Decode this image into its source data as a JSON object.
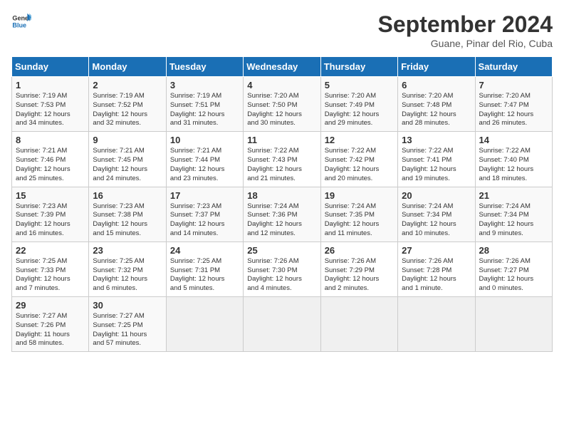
{
  "header": {
    "logo_line1": "General",
    "logo_line2": "Blue",
    "title": "September 2024",
    "subtitle": "Guane, Pinar del Rio, Cuba"
  },
  "days_of_week": [
    "Sunday",
    "Monday",
    "Tuesday",
    "Wednesday",
    "Thursday",
    "Friday",
    "Saturday"
  ],
  "weeks": [
    [
      {
        "num": "1",
        "info": "Sunrise: 7:19 AM\nSunset: 7:53 PM\nDaylight: 12 hours\nand 34 minutes."
      },
      {
        "num": "2",
        "info": "Sunrise: 7:19 AM\nSunset: 7:52 PM\nDaylight: 12 hours\nand 32 minutes."
      },
      {
        "num": "3",
        "info": "Sunrise: 7:19 AM\nSunset: 7:51 PM\nDaylight: 12 hours\nand 31 minutes."
      },
      {
        "num": "4",
        "info": "Sunrise: 7:20 AM\nSunset: 7:50 PM\nDaylight: 12 hours\nand 30 minutes."
      },
      {
        "num": "5",
        "info": "Sunrise: 7:20 AM\nSunset: 7:49 PM\nDaylight: 12 hours\nand 29 minutes."
      },
      {
        "num": "6",
        "info": "Sunrise: 7:20 AM\nSunset: 7:48 PM\nDaylight: 12 hours\nand 28 minutes."
      },
      {
        "num": "7",
        "info": "Sunrise: 7:20 AM\nSunset: 7:47 PM\nDaylight: 12 hours\nand 26 minutes."
      }
    ],
    [
      {
        "num": "8",
        "info": "Sunrise: 7:21 AM\nSunset: 7:46 PM\nDaylight: 12 hours\nand 25 minutes."
      },
      {
        "num": "9",
        "info": "Sunrise: 7:21 AM\nSunset: 7:45 PM\nDaylight: 12 hours\nand 24 minutes."
      },
      {
        "num": "10",
        "info": "Sunrise: 7:21 AM\nSunset: 7:44 PM\nDaylight: 12 hours\nand 23 minutes."
      },
      {
        "num": "11",
        "info": "Sunrise: 7:22 AM\nSunset: 7:43 PM\nDaylight: 12 hours\nand 21 minutes."
      },
      {
        "num": "12",
        "info": "Sunrise: 7:22 AM\nSunset: 7:42 PM\nDaylight: 12 hours\nand 20 minutes."
      },
      {
        "num": "13",
        "info": "Sunrise: 7:22 AM\nSunset: 7:41 PM\nDaylight: 12 hours\nand 19 minutes."
      },
      {
        "num": "14",
        "info": "Sunrise: 7:22 AM\nSunset: 7:40 PM\nDaylight: 12 hours\nand 18 minutes."
      }
    ],
    [
      {
        "num": "15",
        "info": "Sunrise: 7:23 AM\nSunset: 7:39 PM\nDaylight: 12 hours\nand 16 minutes."
      },
      {
        "num": "16",
        "info": "Sunrise: 7:23 AM\nSunset: 7:38 PM\nDaylight: 12 hours\nand 15 minutes."
      },
      {
        "num": "17",
        "info": "Sunrise: 7:23 AM\nSunset: 7:37 PM\nDaylight: 12 hours\nand 14 minutes."
      },
      {
        "num": "18",
        "info": "Sunrise: 7:24 AM\nSunset: 7:36 PM\nDaylight: 12 hours\nand 12 minutes."
      },
      {
        "num": "19",
        "info": "Sunrise: 7:24 AM\nSunset: 7:35 PM\nDaylight: 12 hours\nand 11 minutes."
      },
      {
        "num": "20",
        "info": "Sunrise: 7:24 AM\nSunset: 7:34 PM\nDaylight: 12 hours\nand 10 minutes."
      },
      {
        "num": "21",
        "info": "Sunrise: 7:24 AM\nSunset: 7:34 PM\nDaylight: 12 hours\nand 9 minutes."
      }
    ],
    [
      {
        "num": "22",
        "info": "Sunrise: 7:25 AM\nSunset: 7:33 PM\nDaylight: 12 hours\nand 7 minutes."
      },
      {
        "num": "23",
        "info": "Sunrise: 7:25 AM\nSunset: 7:32 PM\nDaylight: 12 hours\nand 6 minutes."
      },
      {
        "num": "24",
        "info": "Sunrise: 7:25 AM\nSunset: 7:31 PM\nDaylight: 12 hours\nand 5 minutes."
      },
      {
        "num": "25",
        "info": "Sunrise: 7:26 AM\nSunset: 7:30 PM\nDaylight: 12 hours\nand 4 minutes."
      },
      {
        "num": "26",
        "info": "Sunrise: 7:26 AM\nSunset: 7:29 PM\nDaylight: 12 hours\nand 2 minutes."
      },
      {
        "num": "27",
        "info": "Sunrise: 7:26 AM\nSunset: 7:28 PM\nDaylight: 12 hours\nand 1 minute."
      },
      {
        "num": "28",
        "info": "Sunrise: 7:26 AM\nSunset: 7:27 PM\nDaylight: 12 hours\nand 0 minutes."
      }
    ],
    [
      {
        "num": "29",
        "info": "Sunrise: 7:27 AM\nSunset: 7:26 PM\nDaylight: 11 hours\nand 58 minutes."
      },
      {
        "num": "30",
        "info": "Sunrise: 7:27 AM\nSunset: 7:25 PM\nDaylight: 11 hours\nand 57 minutes."
      },
      {
        "num": "",
        "info": ""
      },
      {
        "num": "",
        "info": ""
      },
      {
        "num": "",
        "info": ""
      },
      {
        "num": "",
        "info": ""
      },
      {
        "num": "",
        "info": ""
      }
    ]
  ]
}
